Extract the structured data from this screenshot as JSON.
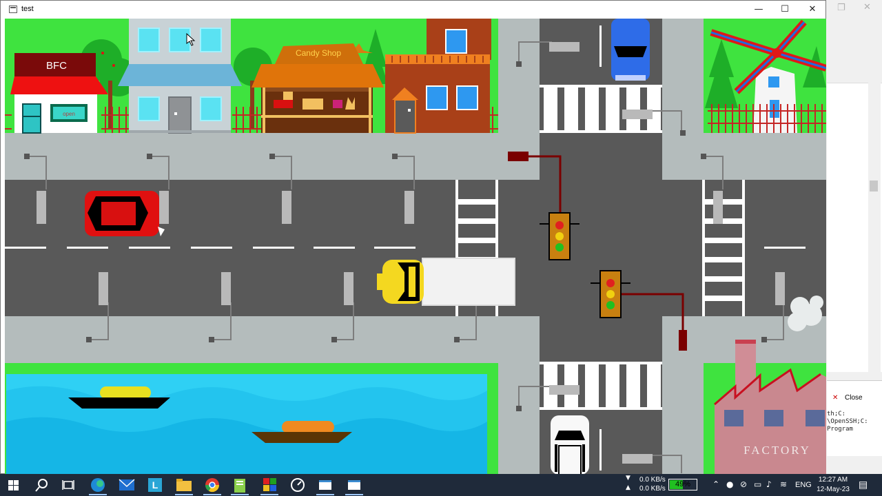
{
  "window": {
    "title": "test",
    "controls": {
      "minimize": "—",
      "maximize": "☐",
      "close": "✕"
    }
  },
  "scene": {
    "shops": {
      "bfc_sign": "BFC",
      "bfc_door_sign": "open",
      "candy_shop_sign": "Candy Shop"
    },
    "factory_sign": "FACTORY"
  },
  "background_window": {
    "controls": {
      "maximize": "❐",
      "close": "✕"
    },
    "tab_label": "Close",
    "terminal_lines": [
      "th;C:",
      "\\OpenSSH;C:",
      "Program"
    ]
  },
  "taskbar": {
    "apps": [
      {
        "name": "start-button",
        "icon": "windows-logo"
      },
      {
        "name": "search-button",
        "icon": "search-icon"
      },
      {
        "name": "task-view-button",
        "icon": "task-view-icon"
      },
      {
        "name": "edge-browser",
        "icon": "edge-icon"
      },
      {
        "name": "mail-app",
        "icon": "mail-icon"
      },
      {
        "name": "l-app",
        "icon": "l-letter-icon"
      },
      {
        "name": "file-explorer",
        "icon": "folder-icon"
      },
      {
        "name": "chrome-browser",
        "icon": "chrome-icon"
      },
      {
        "name": "notepad-plus-plus",
        "icon": "notepad-icon"
      },
      {
        "name": "codeblocks",
        "icon": "codeblocks-icon"
      },
      {
        "name": "speedometer-app",
        "icon": "speedometer-icon"
      },
      {
        "name": "window-app-1",
        "icon": "window-icon"
      },
      {
        "name": "window-app-2",
        "icon": "window-icon"
      }
    ],
    "network": {
      "download": "0.0 KB/s",
      "upload": "0.0 KB/s"
    },
    "battery": {
      "percent_text": "49%",
      "level": 0.49
    },
    "language": "ENG",
    "clock": {
      "time": "12:27 AM",
      "date": "12-May-23"
    }
  },
  "colors": {
    "grass": "#3fe33f",
    "road": "#595959",
    "sidewalk": "#b4bcbc",
    "water": "#2fd0f4",
    "taskbar": "#1f2a3a"
  }
}
